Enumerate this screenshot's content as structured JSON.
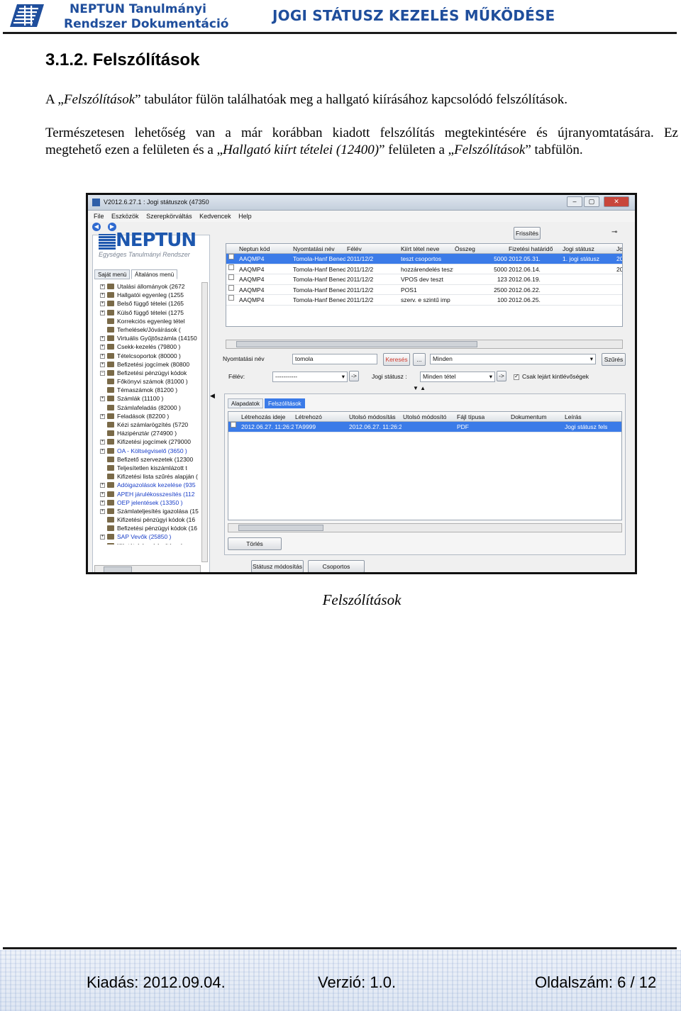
{
  "header": {
    "org_line1": "NEPTUN Tanulmányi",
    "org_line2": "Rendszer Dokumentáció",
    "doc_title": "JOGI STÁTUSZ KEZELÉS MŰKÖDÉSE"
  },
  "section": {
    "title": "3.1.2. Felszólítások",
    "p1_a": "A „",
    "p1_b": "Felszólítások",
    "p1_c": "” tabulátor fülön találhatóak meg a hallgató kiírásához kapcsolódó felszólítások.",
    "p2_line1": "Természetesen lehetőség van a már korábban kiadott felszólítás megtekintésére és újranyomtatására. Ez",
    "p2_a": "megtehető ezen a felületen és a „",
    "p2_b": "Hallgató kiírt tételei (12400)",
    "p2_c": "” felületen a „",
    "p2_d": "Felszólítások",
    "p2_e": "” tabfülön."
  },
  "screenshot": {
    "window_title": "V2012.6.27.1 : Jogi státuszok (47350",
    "window_buttons": [
      "–",
      "▢",
      "✕"
    ],
    "menu": [
      "File",
      "Eszközök",
      "Szerepkörváltás",
      "Kedvencek",
      "Help"
    ],
    "logo_word": "NEPTUN",
    "logo_sub": "Egységes Tanulmányi Rendszer",
    "left_tabs": [
      "Saját menü",
      "Általános menü"
    ],
    "tree": [
      {
        "sign": "+",
        "label": "Utalási állományok (2672",
        "blue": false
      },
      {
        "sign": "+",
        "label": "Hallgatói egyenleg (1255",
        "blue": false
      },
      {
        "sign": "+",
        "label": "Belső függő tételei (1265",
        "blue": false
      },
      {
        "sign": "+",
        "label": "Külső függő tételei (1275",
        "blue": false
      },
      {
        "sign": "",
        "label": "Korrekciós egyenleg tétel",
        "blue": false
      },
      {
        "sign": "",
        "label": "Terhelések/Jóváírások (",
        "blue": false
      },
      {
        "sign": "+",
        "label": "Virtuális Gyűjtőszámla (14150",
        "blue": false
      },
      {
        "sign": "+",
        "label": "Csekk-kezelés (79800 )",
        "blue": false
      },
      {
        "sign": "+",
        "label": "Tételcsoportok (80000 )",
        "blue": false
      },
      {
        "sign": "+",
        "label": "Befizetési jogcímek (80800",
        "blue": false
      },
      {
        "sign": "−",
        "label": "Befizetési pénzügyi kódok",
        "blue": false
      },
      {
        "sign": "",
        "label": "Főkönyvi számok (81000 )",
        "blue": false
      },
      {
        "sign": "",
        "label": "Témaszámok (81200 )",
        "blue": false
      },
      {
        "sign": "+",
        "label": "Számlák (11100 )",
        "blue": false
      },
      {
        "sign": "",
        "label": "Számlafeladás (82000 )",
        "blue": false
      },
      {
        "sign": "+",
        "label": "Feladások (82200 )",
        "blue": false
      },
      {
        "sign": "",
        "label": "Kézi számlarögzítés (5720",
        "blue": false
      },
      {
        "sign": "",
        "label": "Házipénztár (274900 )",
        "blue": false
      },
      {
        "sign": "+",
        "label": "Kifizetési jogcímek (279000",
        "blue": false
      },
      {
        "sign": "+",
        "label": "OA - Költségviselő (3650 )",
        "blue": true
      },
      {
        "sign": "",
        "label": "Befizető szervezetek (12300",
        "blue": false
      },
      {
        "sign": "",
        "label": "Teljesítetlen kiszámlázott t",
        "blue": false
      },
      {
        "sign": "",
        "label": "Kifizetési lista szűrés alapján (",
        "blue": false
      },
      {
        "sign": "+",
        "label": "Adóigazolások kezelése (935",
        "blue": true
      },
      {
        "sign": "+",
        "label": "APEH járulékosszesítés (112",
        "blue": true
      },
      {
        "sign": "+",
        "label": "OEP jelentések (13350 )",
        "blue": true
      },
      {
        "sign": "+",
        "label": "Számlateljesítés igazolása (15",
        "blue": false
      },
      {
        "sign": "",
        "label": "Kifizetési pénzügyi kódok (16",
        "blue": false
      },
      {
        "sign": "",
        "label": "Befizetési pénzügyi kódok (16",
        "blue": false
      },
      {
        "sign": "+",
        "label": "SAP Vevők (25850 )",
        "blue": true
      },
      {
        "sign": "",
        "label": "Kiír tételek módosítása (...",
        "blue": false
      }
    ],
    "refresh_label": "Frissítés",
    "top_grid": {
      "headers": [
        "Neptun kód",
        "Nyomtatási név",
        "Félév",
        "Kiírt tétel neve",
        "Összeg",
        "Fizetési határidő",
        "Jogi státusz",
        "Jo"
      ],
      "rows": [
        {
          "sel": true,
          "cells": [
            "AAQMP4",
            "Tomola-Hanf Bened",
            "2011/12/2",
            "teszt csoportos",
            "5000",
            "2012.05.31.",
            "1. jogi státusz",
            "20"
          ]
        },
        {
          "sel": false,
          "cells": [
            "AAQMP4",
            "Tomola-Hanf Bened",
            "2011/12/2",
            "hozzárendelés teszt",
            "5000",
            "2012.06.14.",
            "",
            "20"
          ]
        },
        {
          "sel": false,
          "cells": [
            "AAQMP4",
            "Tomola-Hanf Bened",
            "2011/12/2",
            "VPOS dev teszt",
            "123",
            "2012.06.19.",
            "",
            ""
          ]
        },
        {
          "sel": false,
          "cells": [
            "AAQMP4",
            "Tomola-Hanf Bened",
            "2011/12/2",
            "POS1",
            "2500",
            "2012.06.22.",
            "",
            ""
          ]
        },
        {
          "sel": false,
          "cells": [
            "AAQMP4",
            "Tomola-Hanf Bened",
            "2011/12/2",
            "szerv. e szintű imp",
            "100",
            "2012.06.25.",
            "",
            ""
          ]
        }
      ]
    },
    "filter": {
      "name_label": "Nyomtatási név",
      "name_value": "tomola",
      "search_label": "Keresés",
      "ellipsis_label": "...",
      "mode_value": "Minden",
      "filter_label": "Szűrés",
      "semester_label": "Félév:",
      "semester_value": "-----------",
      "arrow_label": "->",
      "status_label": "Jogi státusz :",
      "status_value": "Minden tétel",
      "expired_label": "Csak lejárt kintlévőségek"
    },
    "bottom_tabs": [
      "Alapadatok",
      "Felszólítások"
    ],
    "bottom_grid": {
      "headers": [
        "Létrehozás ideje",
        "Létrehozó",
        "Utolsó módosítás",
        "Utolsó módosító",
        "Fájl típusa",
        "Dokumentum",
        "Leírás"
      ],
      "rows": [
        {
          "sel": true,
          "cells": [
            "2012.06.27. 11:26:2",
            "TA9999",
            "2012.06.27. 11:26:2",
            "",
            "PDF",
            "",
            "Jogi státusz felszólít"
          ]
        }
      ]
    },
    "delete_label": "Törlés",
    "status_change_label": "Státusz módosítás",
    "group_print_label": "Csoportos nyomtatás"
  },
  "caption": "Felszólítások",
  "footer": {
    "issue": "Kiadás: 2012.09.04.",
    "version": "Verzió: 1.0.",
    "page": "Oldalszám: 6 / 12"
  },
  "colors": {
    "brand_blue": "#1f4e9c",
    "selection_blue": "#3b7be8",
    "search_red": "#d23a2e"
  }
}
